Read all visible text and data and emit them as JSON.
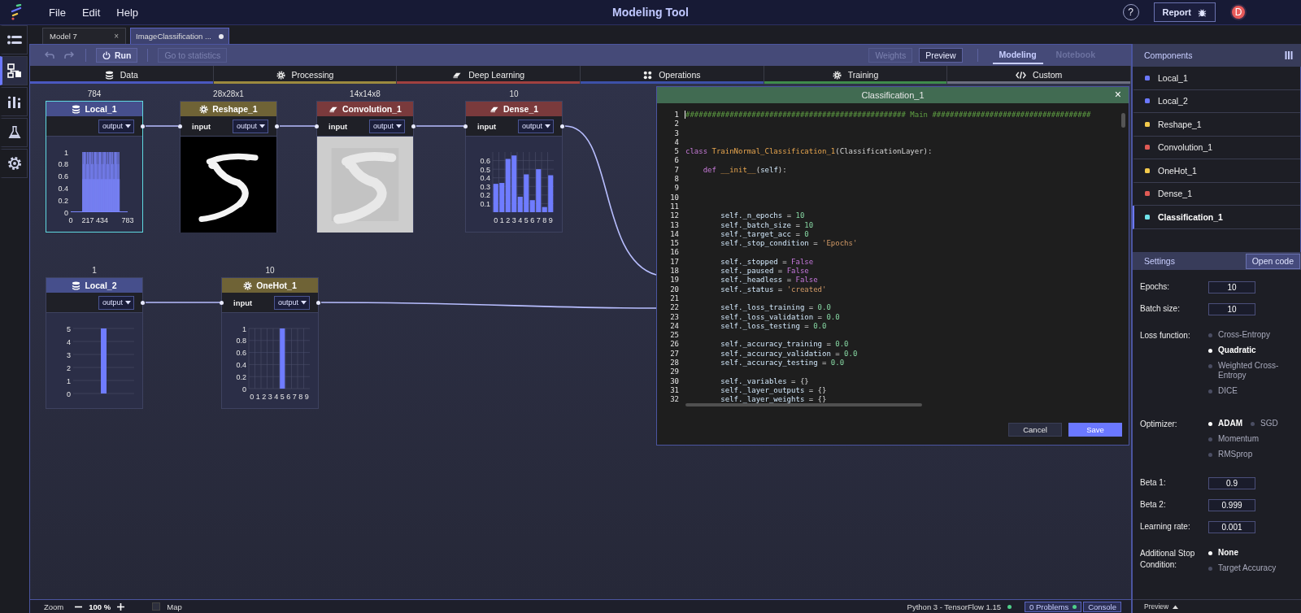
{
  "app": {
    "menu": [
      "File",
      "Edit",
      "Help"
    ],
    "title": "Modeling Tool",
    "help": "?",
    "report": "Report",
    "avatar": "D"
  },
  "rail": [
    {
      "kind": "layers",
      "selected": false
    },
    {
      "kind": "flow",
      "selected": true
    },
    {
      "kind": "chart",
      "selected": false
    },
    {
      "kind": "flask",
      "selected": false
    },
    {
      "kind": "settings",
      "selected": false
    }
  ],
  "doc_tabs": [
    {
      "label": "Model 7",
      "selected": false,
      "close": "×",
      "unsaved": false
    },
    {
      "label": "ImageClassification ...",
      "selected": true,
      "unsaved": true
    }
  ],
  "toolbar": {
    "undo": {
      "disabled": true
    },
    "redo": {
      "disabled": true
    },
    "run": "Run",
    "statistics": {
      "label": "Go to statistics",
      "disabled": true
    },
    "weights": {
      "label": "Weights",
      "disabled": true
    },
    "preview": {
      "label": "Preview",
      "disabled": false
    },
    "views": [
      {
        "label": "Modeling",
        "selected": true
      },
      {
        "label": "Notebook",
        "selected": false
      }
    ]
  },
  "categories": [
    {
      "label": "Data",
      "kind": "database",
      "color": "#4a58c0"
    },
    {
      "label": "Processing",
      "kind": "gear",
      "color": "#9c8a3e"
    },
    {
      "label": "Deep Learning",
      "kind": "eraser",
      "color": "#a0403f"
    },
    {
      "label": "Operations",
      "kind": "dots",
      "color": "#3c50a8"
    },
    {
      "label": "Training",
      "kind": "gear",
      "color": "#3f8c4c"
    },
    {
      "label": "Custom",
      "kind": "code",
      "color": "#6c6f80"
    }
  ],
  "nodes": [
    {
      "name": "Local_1",
      "kind": "data",
      "shape": "784",
      "selected": true,
      "output": "output",
      "output_connected": true,
      "preview": {
        "kind": "histogram",
        "yticks": [
          "1",
          "0.8",
          "0.6",
          "0.4",
          "0.2",
          "0"
        ],
        "xticks": [
          "0",
          "217",
          "434",
          "783"
        ]
      }
    },
    {
      "name": "Reshape_1",
      "kind": "processing",
      "shape": "28x28x1",
      "selected": false,
      "input": "input",
      "output": "output",
      "output_connected": true,
      "preview": {
        "kind": "picture",
        "dark": true
      }
    },
    {
      "name": "Convolution_1",
      "kind": "deep_learning",
      "shape": "14x14x8",
      "selected": false,
      "input": "input",
      "output": "output",
      "output_connected": true,
      "preview": {
        "kind": "picture",
        "dark": false
      }
    },
    {
      "name": "Dense_1",
      "kind": "deep_learning",
      "shape": "10",
      "selected": false,
      "input": "input",
      "output": "output",
      "output_connected": true,
      "preview": {
        "kind": "chart",
        "chart_data": {
          "type": "bar",
          "grid": true,
          "categories": [
            "0",
            "1",
            "2",
            "3",
            "4",
            "5",
            "6",
            "7",
            "8",
            "9"
          ],
          "values": [
            0.33,
            0.34,
            0.62,
            0.66,
            0.18,
            0.44,
            0.14,
            0.5,
            0.06,
            0.43
          ],
          "ylim": [
            0,
            0.7
          ],
          "yticks": [
            0.1,
            0.2,
            0.3,
            0.4,
            0.5,
            0.6
          ]
        }
      }
    },
    {
      "name": "Local_2",
      "kind": "data",
      "shape": "1",
      "selected": false,
      "output": "output",
      "output_connected": true,
      "preview": {
        "kind": "chart",
        "chart_data": {
          "type": "bar",
          "grid": true,
          "values": [
            5
          ],
          "ylim": [
            0,
            5
          ],
          "yticks": [
            0,
            1,
            2,
            3,
            4,
            5
          ]
        }
      }
    },
    {
      "name": "OneHot_1",
      "kind": "processing",
      "shape": "10",
      "selected": false,
      "input": "input",
      "output": "output",
      "output_connected": true,
      "preview": {
        "kind": "chart",
        "chart_data": {
          "type": "bar",
          "grid": true,
          "categories": [
            "0",
            "1",
            "2",
            "3",
            "4",
            "5",
            "6",
            "7",
            "8",
            "9"
          ],
          "values": [
            0,
            0,
            0,
            0,
            0,
            1,
            0,
            0,
            0,
            0
          ],
          "ylim": [
            0,
            1
          ],
          "yticks": [
            0,
            0.2,
            0.4,
            0.6,
            0.8,
            1
          ]
        }
      }
    }
  ],
  "dialog": {
    "title": "Classification_1",
    "close": "×",
    "cancel": "Cancel",
    "save": "Save",
    "lines": [
      {
        "number": "1",
        "segments": [
          {
            "kind": "comment",
            "text": "################################################## Main ####################################"
          }
        ]
      },
      {
        "number": "2"
      },
      {
        "number": "3"
      },
      {
        "number": "4"
      },
      {
        "number": "5",
        "segments": [
          {
            "kind": "keyword",
            "text": "class "
          },
          {
            "kind": "name",
            "text": "TrainNormal_Classification_1"
          },
          {
            "kind": "plain",
            "text": "(ClassificationLayer):"
          }
        ]
      },
      {
        "number": "6"
      },
      {
        "number": "7",
        "segments": [
          {
            "kind": "keyword",
            "text": "    def "
          },
          {
            "kind": "name",
            "text": "__init__"
          },
          {
            "kind": "plain",
            "text": "("
          },
          {
            "kind": "attr",
            "text": "self"
          },
          {
            "kind": "plain",
            "text": "):"
          }
        ]
      },
      {
        "number": "8"
      },
      {
        "number": "9"
      },
      {
        "number": "10"
      },
      {
        "number": "11"
      },
      {
        "number": "12",
        "segments": [
          {
            "kind": "attr",
            "text": "        self._n_epochs"
          },
          {
            "kind": "plain",
            "text": " = "
          },
          {
            "kind": "number",
            "text": "10"
          }
        ]
      },
      {
        "number": "13",
        "segments": [
          {
            "kind": "attr",
            "text": "        self._batch_size"
          },
          {
            "kind": "plain",
            "text": " = "
          },
          {
            "kind": "number",
            "text": "10"
          }
        ]
      },
      {
        "number": "14",
        "segments": [
          {
            "kind": "attr",
            "text": "        self._target_acc"
          },
          {
            "kind": "plain",
            "text": " = "
          },
          {
            "kind": "number",
            "text": "0"
          }
        ]
      },
      {
        "number": "15",
        "segments": [
          {
            "kind": "attr",
            "text": "        self._stop_condition"
          },
          {
            "kind": "plain",
            "text": " = "
          },
          {
            "kind": "string",
            "text": "'Epochs'"
          }
        ]
      },
      {
        "number": "16"
      },
      {
        "number": "17",
        "segments": [
          {
            "kind": "attr",
            "text": "        self._stopped"
          },
          {
            "kind": "plain",
            "text": " = "
          },
          {
            "kind": "const",
            "text": "False"
          }
        ]
      },
      {
        "number": "18",
        "segments": [
          {
            "kind": "attr",
            "text": "        self._paused"
          },
          {
            "kind": "plain",
            "text": " = "
          },
          {
            "kind": "const",
            "text": "False"
          }
        ]
      },
      {
        "number": "19",
        "segments": [
          {
            "kind": "attr",
            "text": "        self._headless"
          },
          {
            "kind": "plain",
            "text": " = "
          },
          {
            "kind": "const",
            "text": "False"
          }
        ]
      },
      {
        "number": "20",
        "segments": [
          {
            "kind": "attr",
            "text": "        self._status"
          },
          {
            "kind": "plain",
            "text": " = "
          },
          {
            "kind": "string",
            "text": "'created'"
          }
        ]
      },
      {
        "number": "21"
      },
      {
        "number": "22",
        "segments": [
          {
            "kind": "attr",
            "text": "        self._loss_training"
          },
          {
            "kind": "plain",
            "text": " = "
          },
          {
            "kind": "number",
            "text": "0.0"
          }
        ]
      },
      {
        "number": "23",
        "segments": [
          {
            "kind": "attr",
            "text": "        self._loss_validation"
          },
          {
            "kind": "plain",
            "text": " = "
          },
          {
            "kind": "number",
            "text": "0.0"
          }
        ]
      },
      {
        "number": "24",
        "segments": [
          {
            "kind": "attr",
            "text": "        self._loss_testing"
          },
          {
            "kind": "plain",
            "text": " = "
          },
          {
            "kind": "number",
            "text": "0.0"
          }
        ]
      },
      {
        "number": "25"
      },
      {
        "number": "26",
        "segments": [
          {
            "kind": "attr",
            "text": "        self._accuracy_training"
          },
          {
            "kind": "plain",
            "text": " = "
          },
          {
            "kind": "number",
            "text": "0.0"
          }
        ]
      },
      {
        "number": "27",
        "segments": [
          {
            "kind": "attr",
            "text": "        self._accuracy_validation"
          },
          {
            "kind": "plain",
            "text": " = "
          },
          {
            "kind": "number",
            "text": "0.0"
          }
        ]
      },
      {
        "number": "28",
        "segments": [
          {
            "kind": "attr",
            "text": "        self._accuracy_testing"
          },
          {
            "kind": "plain",
            "text": " = "
          },
          {
            "kind": "number",
            "text": "0.0"
          }
        ]
      },
      {
        "number": "29"
      },
      {
        "number": "30",
        "segments": [
          {
            "kind": "attr",
            "text": "        self._variables"
          },
          {
            "kind": "plain",
            "text": " = {}"
          }
        ]
      },
      {
        "number": "31",
        "segments": [
          {
            "kind": "attr",
            "text": "        self._layer_outputs"
          },
          {
            "kind": "plain",
            "text": " = {}"
          }
        ]
      },
      {
        "number": "32",
        "segments": [
          {
            "kind": "attr",
            "text": "        self._layer_weights"
          },
          {
            "kind": "plain",
            "text": " = {}"
          }
        ]
      }
    ]
  },
  "components": {
    "title": "Components",
    "items": [
      {
        "name": "Local_1",
        "color": "#6b78ff",
        "selected": false
      },
      {
        "name": "Local_2",
        "color": "#6b78ff",
        "selected": false
      },
      {
        "name": "Reshape_1",
        "color": "#f2c94c",
        "selected": false
      },
      {
        "name": "Convolution_1",
        "color": "#e05a55",
        "selected": false
      },
      {
        "name": "OneHot_1",
        "color": "#f2c94c",
        "selected": false
      },
      {
        "name": "Dense_1",
        "color": "#e05a55",
        "selected": false
      },
      {
        "name": "Classification_1",
        "color": "#6fe3ea",
        "selected": true
      }
    ]
  },
  "settings": {
    "title": "Settings",
    "open_code": "Open code",
    "rows": [
      {
        "kind": "field",
        "label": "Epochs:",
        "value": "10"
      },
      {
        "kind": "field",
        "label": "Batch size:",
        "value": "10"
      },
      {
        "kind": "radio",
        "label": "Loss function:",
        "options": [
          {
            "label": "Cross-Entropy",
            "selected": false
          },
          {
            "label": "Quadratic",
            "selected": true
          },
          {
            "label": "Weighted Cross-Entropy",
            "selected": false
          },
          {
            "label": "DICE",
            "selected": false
          }
        ]
      },
      {
        "kind": "radio",
        "label": "Optimizer:",
        "options": [
          {
            "label": "ADAM",
            "selected": true
          },
          {
            "label": "SGD",
            "selected": false
          },
          {
            "label": "Momentum",
            "selected": false
          },
          {
            "label": "RMSprop",
            "selected": false
          }
        ]
      },
      {
        "kind": "field",
        "label": "Beta 1:",
        "value": "0.9"
      },
      {
        "kind": "field",
        "label": "Beta 2:",
        "value": "0.999"
      },
      {
        "kind": "field",
        "label": "Learning rate:",
        "value": "0.001"
      },
      {
        "kind": "radio",
        "label": "Additional Stop Condition:",
        "options": [
          {
            "label": "None",
            "selected": true
          },
          {
            "label": "Target Accuracy",
            "selected": false
          }
        ]
      }
    ]
  },
  "preview_footer": "Preview",
  "status": {
    "zoom": "Zoom",
    "zoom_value": "100 %",
    "map": {
      "label": "Map",
      "checked": false
    },
    "runtime": "Python 3 - TensorFlow 1.15",
    "problems": "0 Problems",
    "console": "Console"
  }
}
